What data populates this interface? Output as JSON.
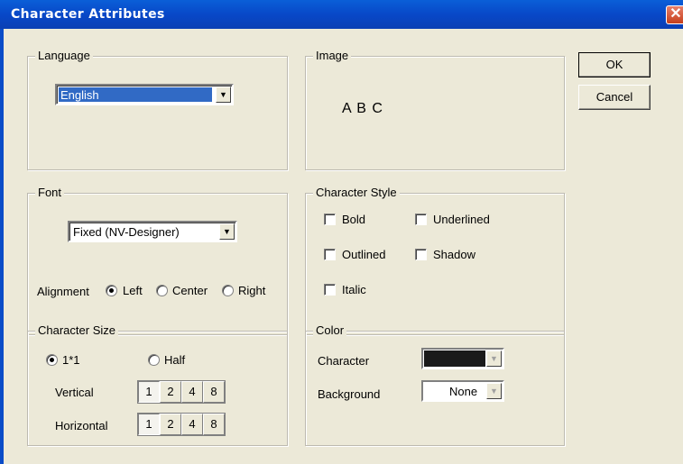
{
  "window": {
    "title": "Character Attributes",
    "close_glyph": "✕"
  },
  "buttons": {
    "ok": "OK",
    "cancel": "Cancel"
  },
  "language": {
    "group_label": "Language",
    "selected": "English"
  },
  "image": {
    "group_label": "Image",
    "preview_text": "A B C"
  },
  "font": {
    "group_label": "Font",
    "selected": "Fixed (NV-Designer)",
    "alignment_label": "Alignment",
    "alignment_options": [
      "Left",
      "Center",
      "Right"
    ],
    "alignment_selected": "Left"
  },
  "character_style": {
    "group_label": "Character Style",
    "bold": "Bold",
    "underlined": "Underlined",
    "outlined": "Outlined",
    "shadow": "Shadow",
    "italic": "Italic"
  },
  "character_size": {
    "group_label": "Character Size",
    "option_full": "1*1",
    "option_half": "Half",
    "selected": "1*1",
    "vertical_label": "Vertical",
    "horizontal_label": "Horizontal",
    "scale_values": [
      "1",
      "2",
      "4",
      "8"
    ],
    "vertical_selected": "1",
    "horizontal_selected": "1"
  },
  "color": {
    "group_label": "Color",
    "character_label": "Character",
    "character_color": "#1a1a1a",
    "background_label": "Background",
    "background_value": "None"
  },
  "icons": {
    "dropdown": "chevron-down-icon",
    "close": "close-icon"
  }
}
